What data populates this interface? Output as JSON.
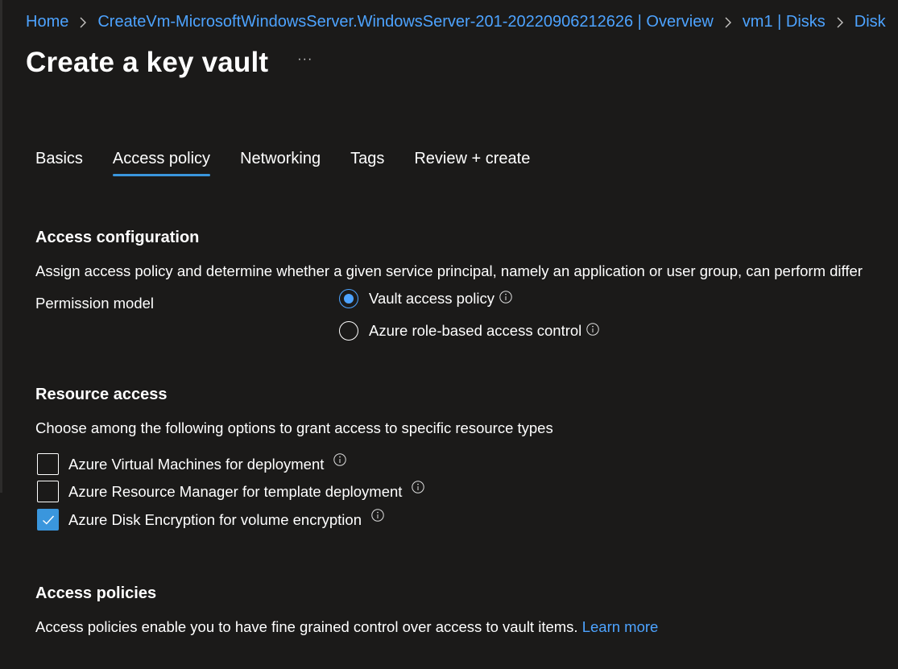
{
  "breadcrumb": {
    "items": [
      "Home",
      "CreateVm-MicrosoftWindowsServer.WindowsServer-201-20220906212626 | Overview",
      "vm1 | Disks",
      "Disk"
    ]
  },
  "page": {
    "title": "Create a key vault",
    "more_label": "···"
  },
  "tabs": [
    {
      "label": "Basics",
      "active": false
    },
    {
      "label": "Access policy",
      "active": true
    },
    {
      "label": "Networking",
      "active": false
    },
    {
      "label": "Tags",
      "active": false
    },
    {
      "label": "Review + create",
      "active": false
    }
  ],
  "access_configuration": {
    "heading": "Access configuration",
    "description": "Assign access policy and determine whether a given service principal, namely an application or user group, can perform differ",
    "permission_model_label": "Permission model",
    "options": [
      {
        "label": "Vault access policy",
        "selected": true,
        "icon": "info-icon"
      },
      {
        "label": "Azure role-based access control",
        "selected": false,
        "icon": "info-icon"
      }
    ]
  },
  "resource_access": {
    "heading": "Resource access",
    "description": "Choose among the following options to grant access to specific resource types",
    "options": [
      {
        "label": "Azure Virtual Machines for deployment",
        "checked": false,
        "icon": "info-icon"
      },
      {
        "label": "Azure Resource Manager for template deployment",
        "checked": false,
        "icon": "info-icon"
      },
      {
        "label": "Azure Disk Encryption for volume encryption",
        "checked": true,
        "icon": "info-icon"
      }
    ]
  },
  "access_policies": {
    "heading": "Access policies",
    "description": "Access policies enable you to have fine grained control over access to vault items.",
    "link_label": "Learn more"
  },
  "colors": {
    "background": "#1b1a19",
    "accent": "#4da3ff",
    "checkbox_fill": "#3a96dd",
    "text": "#ffffff"
  }
}
